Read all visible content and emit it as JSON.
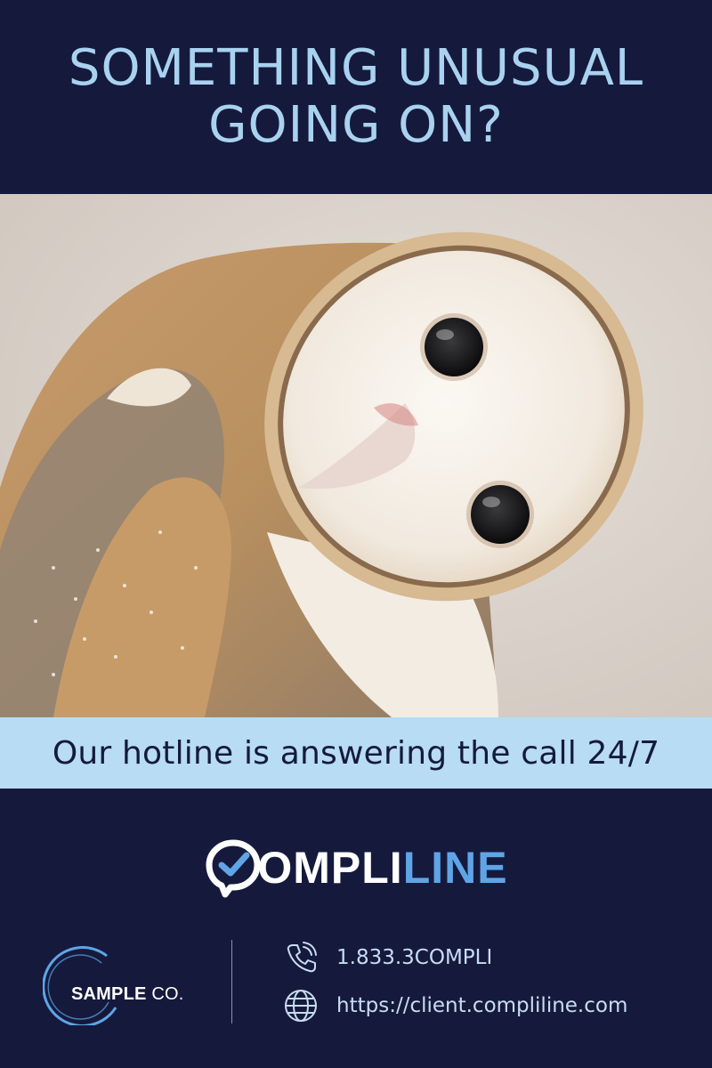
{
  "header": {
    "headline_line1": "SOMETHING UNUSUAL",
    "headline_line2": "GOING ON?"
  },
  "photo": {
    "subject_icon": "barn-owl-photo"
  },
  "banner": {
    "text": "Our hotline is answering the call 24/7"
  },
  "brand": {
    "logo_icon": "speech-bubble-check-icon",
    "word_part1": "OMPLI",
    "word_part2": "LINE"
  },
  "company": {
    "logo_icon": "ring-logo-icon",
    "name_bold": "SAMPLE",
    "name_regular": "CO."
  },
  "contact": {
    "phone_icon": "phone-icon",
    "phone": "1.833.3COMPLI",
    "web_icon": "globe-icon",
    "url": "https://client.compliline.com"
  },
  "colors": {
    "background": "#151a3d",
    "headline": "#a9d2f0",
    "banner_bg": "#b7dcf3",
    "brand_accent": "#5fa5e6"
  }
}
